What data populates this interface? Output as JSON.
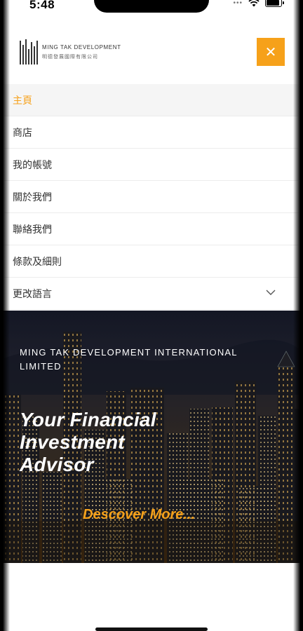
{
  "status_bar": {
    "time": "5:48",
    "signal_icon": "signal-dots-icon",
    "wifi_icon": "wifi-icon",
    "battery_icon": "battery-icon",
    "battery_level": 0.9
  },
  "header": {
    "logo_en": "MING TAK DEVELOPMENT",
    "logo_zh": "明德發展國際有限公司",
    "close_label": "✕",
    "close_icon": "close-icon",
    "accent_color": "#f6a11a"
  },
  "menu": {
    "items": [
      {
        "label": "主頁"
      },
      {
        "label": "商店"
      },
      {
        "label": "我的帳號"
      },
      {
        "label": "關於我們"
      },
      {
        "label": "聯絡我們"
      },
      {
        "label": "條款及細則"
      },
      {
        "label": "更改語言"
      }
    ],
    "active_index": 0,
    "chevron_icon": "chevron-down-icon"
  },
  "hero": {
    "company": "MING TAK DEVELOPMENT INTERNATIONAL LIMITED",
    "tagline": "Your Financial Investment Advisor",
    "cta": "Descover More..."
  }
}
